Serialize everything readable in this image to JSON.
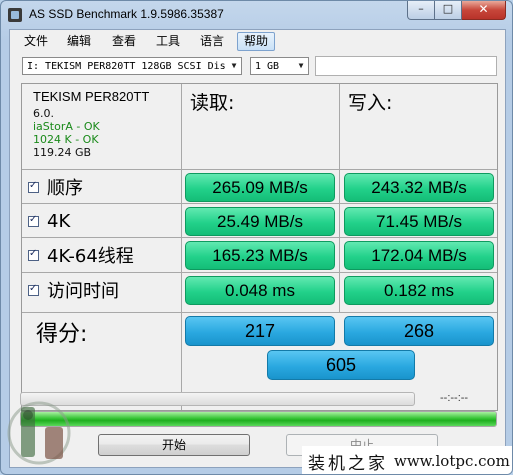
{
  "window": {
    "title": "AS SSD Benchmark 1.9.5986.35387",
    "minimize_glyph": "–",
    "maximize_glyph": "□",
    "close_glyph": "✕"
  },
  "menu": {
    "items": [
      {
        "label": "文件"
      },
      {
        "label": "编辑"
      },
      {
        "label": "查看"
      },
      {
        "label": "工具"
      },
      {
        "label": "语言"
      },
      {
        "label": "帮助"
      }
    ]
  },
  "toolbar": {
    "drive_selected": "I: TEKISM PER820TT 128GB SCSI Dis",
    "size_selected": "1 GB",
    "dropdown_glyph": "▼"
  },
  "device_info": {
    "name": "TEKISM PER820TT",
    "firmware": "6.0.",
    "driver_status": "iaStorA - OK",
    "alignment_status": "1024 K - OK",
    "capacity": "119.24 GB"
  },
  "columns": {
    "read": "读取:",
    "write": "写入:"
  },
  "rows": [
    {
      "label": "顺序",
      "read": "265.09 MB/s",
      "write": "243.32 MB/s",
      "checked": true
    },
    {
      "label": "4K",
      "read": "25.49 MB/s",
      "write": "71.45 MB/s",
      "checked": true
    },
    {
      "label": "4K-64线程",
      "read": "165.23 MB/s",
      "write": "172.04 MB/s",
      "checked": true
    },
    {
      "label": "访问时间",
      "read": "0.048 ms",
      "write": "0.182 ms",
      "checked": true
    }
  ],
  "score": {
    "label": "得分:",
    "read": "217",
    "write": "268",
    "total": "605"
  },
  "progress": {
    "elapsed": "--:--:--",
    "overall_fraction": 1.0
  },
  "buttons": {
    "start": "开始",
    "abort": "中止"
  },
  "watermark": {
    "site_name": "装机之家",
    "url": "www.lotpc.com"
  },
  "colors": {
    "result_green": "#22d18a",
    "score_blue": "#2aa8e0",
    "status_ok": "#1a8a1a"
  }
}
